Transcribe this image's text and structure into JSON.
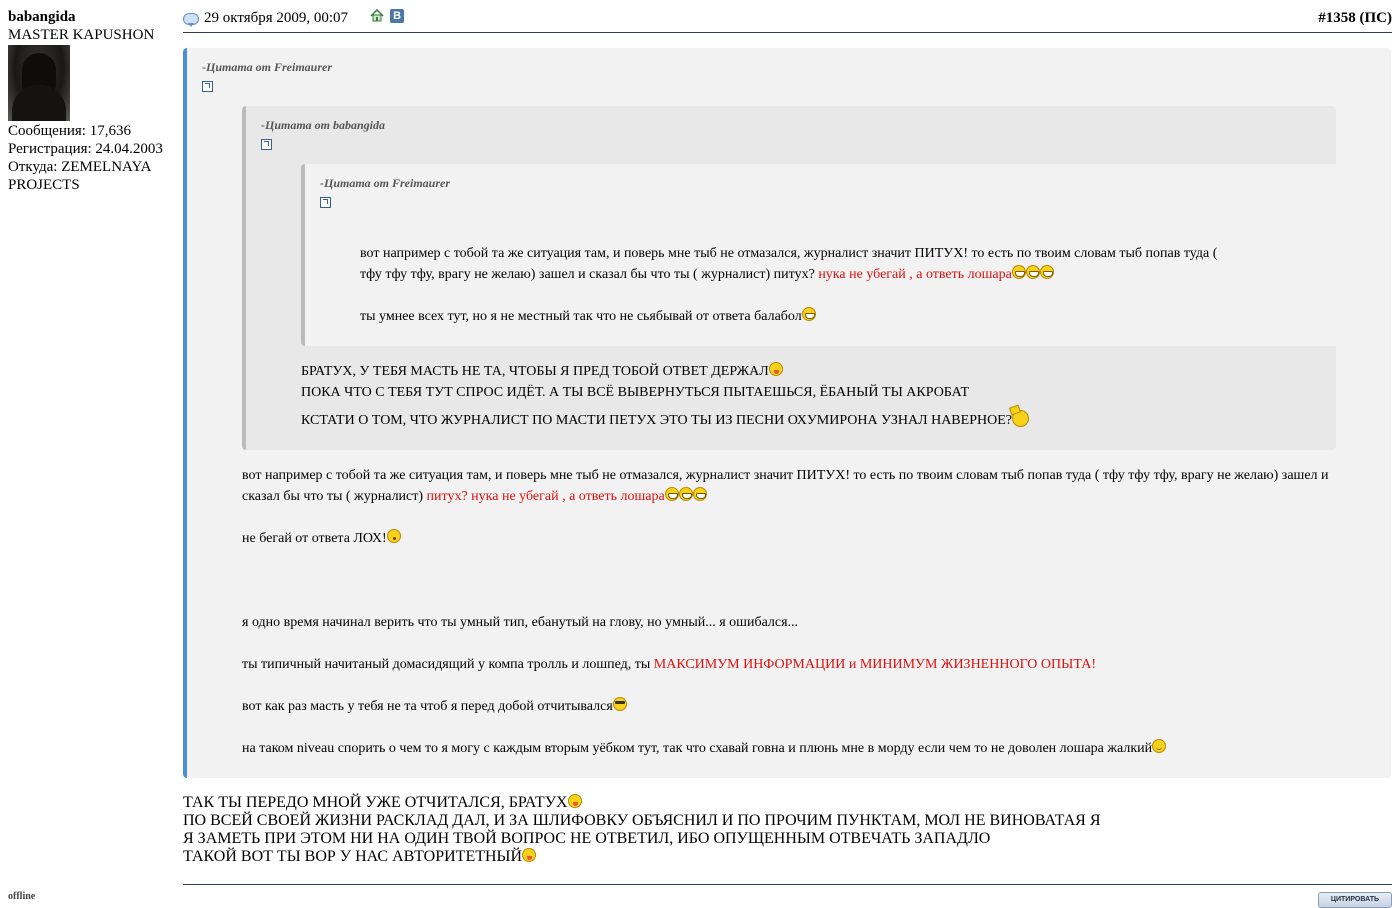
{
  "user": {
    "name": "babangida",
    "title": "MASTER KAPUSHON",
    "posts": "Сообщения: 17,636",
    "registered": "Регистрация: 24.04.2003",
    "location_line1": "Откуда: ZEMELNAYA",
    "location_line2": "PROJECTS",
    "status": "offline"
  },
  "post": {
    "date": "29 октября 2009, 00:07",
    "vk_label": "В",
    "number": "#1358",
    "number_suffix": "(ПС)"
  },
  "quotes": {
    "outer_author": "-Цитата от Freimaurer",
    "middle_author": "-Цитата от babangida",
    "inner_author": "-Цитата от Freimaurer",
    "inner_line1": "вот например с тобой та же ситуация там, и поверь мне тыб не отмазался, журналист значит ПИТУХ! то есть по твоим словам тыб попав туда (",
    "inner_line2": "тфу тфу тфу, врагу не желаю) зашел и сказал бы что ты ( журналист) питух? ",
    "inner_line2_red": "нука не убегай , а ответь лошара",
    "inner_line3": "ты умнее всех тут, но я не местный так что не сьябывай от ответа балабол",
    "middle_line1": "БРАТУХ, У ТЕБЯ МАСТЬ НЕ ТА, ЧТОБЫ Я ПРЕД ТОБОЙ ОТВЕТ ДЕРЖАЛ",
    "middle_line2": "ПОКА ЧТО С ТЕБЯ ТУТ СПРОС ИДЁТ. А ТЫ ВСЁ ВЫВЕРНУТЬСЯ ПЫТАЕШЬСЯ, ЁБАНЫЙ ТЫ АКРОБАТ",
    "middle_line3": "КСТАТИ О ТОМ, ЧТО ЖУРНАЛИСТ ПО МАСТИ ПЕТУХ ЭТО ТЫ ИЗ ПЕСНИ ОХУМИРОНА УЗНАЛ НАВЕРНОЕ?",
    "outer_line1": "вот например с тобой та же ситуация там, и поверь мне тыб не отмазался, журналист значит ПИТУХ! то есть по твоим словам тыб попав туда ( тфу тфу тфу, врагу не желаю) зашел и",
    "outer_line2": "сказал бы что ты ( журналист) ",
    "outer_line2_red": "питух? нука не убегай , а ответь лошара",
    "outer_line3": "не бегай от ответа ЛОХ!",
    "outer_line4": "я одно время начинал верить что ты умный тип, ебанутый на глову, но умный... я ошибался...",
    "outer_line5": "ты типичный начитаный домасидящий у компа тролль и лошпед, ты ",
    "outer_line5_red": "МАКСИМУМ ИНФОРМАЦИИ и МИНИМУМ ЖИЗНЕННОГО ОПЫТА!",
    "outer_line6": "вот как раз масть у тебя не та чтоб я перед добой отчитывался",
    "outer_line7": "на таком niveau спорить о чем то я могу с каждым вторым уёбком тут, так что схавай говна и плюнь мне в морду если чем то не доволен лошара жалкий"
  },
  "reply": {
    "line1": "ТАК ТЫ ПЕРЕДО МНОЙ УЖЕ ОТЧИТАЛСЯ, БРАТУХ",
    "line2": "ПО ВСЕЙ СВОЕЙ ЖИЗНИ РАСКЛАД ДАЛ, И ЗА ШЛИФОВКУ ОБЪЯСНИЛ И ПО ПРОЧИМ ПУНКТАМ, МОЛ НЕ ВИНОВАТАЯ Я",
    "line3": "Я ЗАМЕТЬ ПРИ ЭТОМ НИ НА ОДИН ТВОЙ ВОПРОС НЕ ОТВЕТИЛ, ИБО ОПУЩЕННЫМ ОТВЕЧАТЬ ЗАПАДЛО",
    "line4": "ТАКОЙ ВОТ ТЫ ВОР У НАС АВТОРИТЕТНЫЙ"
  },
  "quote_button": "ЦИТИРОВАТЬ",
  "icons": [
    "post-bubble-icon",
    "home-icon",
    "vk-icon",
    "quote-link-icon",
    "grin-smiley-icon",
    "tongue-smiley-icon",
    "smile-smiley-icon",
    "shock-smiley-icon",
    "cool-smiley-icon",
    "crown-smiley-icon"
  ]
}
